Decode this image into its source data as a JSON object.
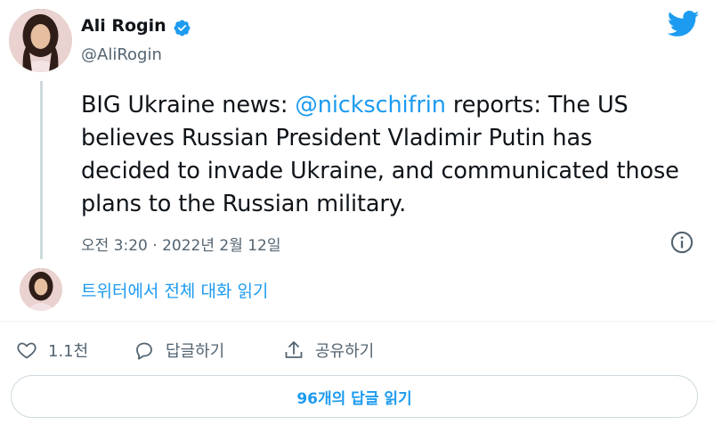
{
  "author": {
    "name": "Ali Rogin",
    "handle": "@AliRogin",
    "avatar_icon": "profile-photo",
    "verified_icon": "verified-badge-icon"
  },
  "brand": {
    "icon": "twitter-bird-icon",
    "color": "#1d9bf0"
  },
  "tweet": {
    "text_before": "BIG Ukraine news: ",
    "mention": "@nickschifrin",
    "text_after": " reports: The US believes Russian President Vladimir Putin has decided to invade Ukraine, and communicated those plans to the Russian military.",
    "timestamp": "오전 3:20 · 2022년 2월 12일"
  },
  "thread": {
    "read_label": "트위터에서 전체 대화 읽기"
  },
  "actions": {
    "like_count": "1.1천",
    "reply_label": "답글하기",
    "share_label": "공유하기"
  },
  "replies": {
    "button_label": "96개의 답글 읽기"
  }
}
